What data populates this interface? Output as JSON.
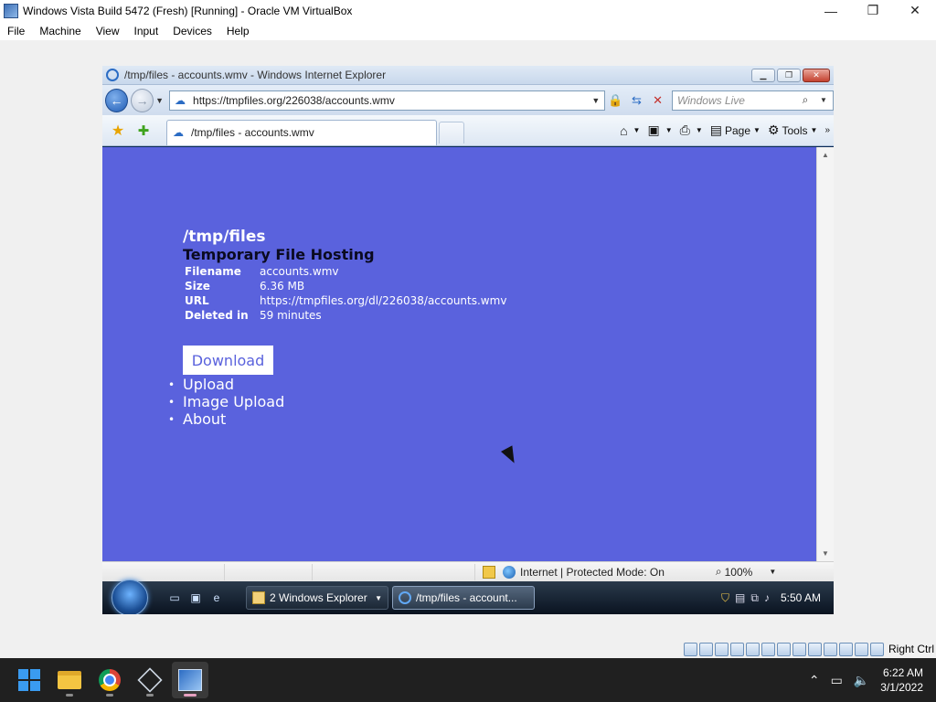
{
  "vbox": {
    "title": "Windows Vista Build 5472 (Fresh) [Running] - Oracle VM VirtualBox",
    "menu": [
      "File",
      "Machine",
      "View",
      "Input",
      "Devices",
      "Help"
    ],
    "window_controls": {
      "minimize": "—",
      "restore": "❐",
      "close": "✕"
    },
    "host_key": "Right Ctrl",
    "status_icons": [
      "hard-disk",
      "optical-drive",
      "floppy",
      "audio",
      "network",
      "usb",
      "shared-folders",
      "display",
      "video-capture",
      "snapshot",
      "cpu",
      "mouse-integration",
      "host-key"
    ]
  },
  "ie": {
    "title": "/tmp/files - accounts.wmv - Windows Internet Explorer",
    "address": "https://tmpfiles.org/226038/accounts.wmv",
    "search_placeholder": "Windows Live",
    "tab_label": "/tmp/files - accounts.wmv",
    "commands": {
      "page": "Page",
      "tools": "Tools"
    },
    "status": {
      "zone": "Internet | Protected Mode: On",
      "zoom": "100%"
    }
  },
  "page": {
    "title": "/tmp/files",
    "subtitle": "Temporary File Hosting",
    "info": [
      {
        "key": "Filename",
        "value": "accounts.wmv"
      },
      {
        "key": "Size",
        "value": "6.36 MB"
      },
      {
        "key": "URL",
        "value": "https://tmpfiles.org/dl/226038/accounts.wmv"
      },
      {
        "key": "Deleted in",
        "value": "59 minutes"
      }
    ],
    "download_label": "Download",
    "nav": [
      "Upload",
      "Image Upload",
      "About"
    ],
    "colors": {
      "background": "#5a62dd",
      "title": "#ffffff",
      "subtitle": "#0a0a20"
    }
  },
  "vista_taskbar": {
    "explorer_label": "2 Windows Explorer",
    "ie_label": "/tmp/files - account...",
    "time": "5:50 AM"
  },
  "host_taskbar": {
    "apps": [
      "windows-start",
      "file-explorer",
      "chrome",
      "virtualbox",
      "vista-vm"
    ],
    "time": "6:22 AM",
    "date": "3/1/2022"
  }
}
